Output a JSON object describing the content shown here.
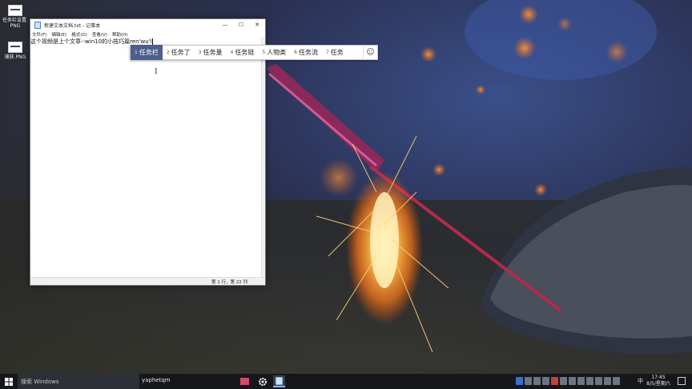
{
  "desktop": {
    "icons": [
      {
        "label": "任务栏设置.PNG"
      },
      {
        "label": "捕获.PNG"
      }
    ]
  },
  "notepad": {
    "title": "新建文本文档.txt - 记事本",
    "menu": [
      "文件(F)",
      "编辑(E)",
      "格式(O)",
      "查看(V)",
      "帮助(H)"
    ],
    "text": "这个视频是上个文章--win10的小技巧篇",
    "composition": "ren'wu'l",
    "status": "第 1 行，第 22 列",
    "buttons": {
      "minimize": "—",
      "maximize": "☐",
      "close": "✕"
    }
  },
  "ime": {
    "candidates": [
      {
        "num": "1",
        "text": "任务栏",
        "selected": true
      },
      {
        "num": "2",
        "text": "任务了",
        "selected": false
      },
      {
        "num": "3",
        "text": "任务量",
        "selected": false
      },
      {
        "num": "4",
        "text": "任务链",
        "selected": false
      },
      {
        "num": "5",
        "text": "人物类",
        "selected": false
      },
      {
        "num": "6",
        "text": "任务流",
        "selected": false
      },
      {
        "num": "7",
        "text": "任务",
        "selected": false
      }
    ],
    "emoji": "☺"
  },
  "taskbar": {
    "search_placeholder": "搜索 Windows",
    "task_label": "yaphetqm",
    "ime_indicator": "中",
    "time": "17:45",
    "date": "8/5/星期六"
  },
  "colors": {
    "ime_selected": "#4a5f8c",
    "taskbar": "#15171b"
  }
}
